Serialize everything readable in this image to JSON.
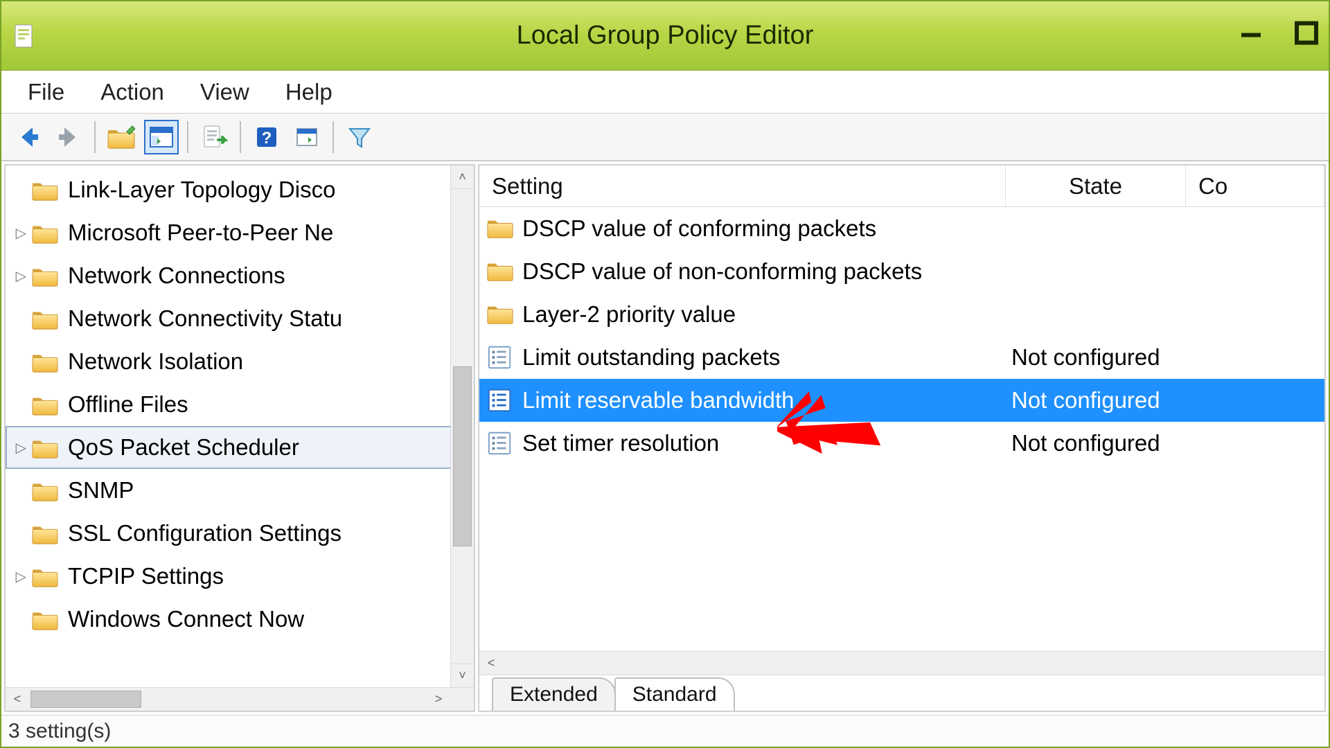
{
  "window": {
    "title": "Local Group Policy Editor"
  },
  "menu": {
    "file": "File",
    "action": "Action",
    "view": "View",
    "help": "Help"
  },
  "tree": {
    "items": [
      {
        "label": "Link-Layer Topology Disco",
        "expandable": false,
        "selected": false
      },
      {
        "label": "Microsoft Peer-to-Peer Ne",
        "expandable": true,
        "selected": false
      },
      {
        "label": "Network Connections",
        "expandable": true,
        "selected": false
      },
      {
        "label": "Network Connectivity Statu",
        "expandable": false,
        "selected": false
      },
      {
        "label": "Network Isolation",
        "expandable": false,
        "selected": false
      },
      {
        "label": "Offline Files",
        "expandable": false,
        "selected": false
      },
      {
        "label": "QoS Packet Scheduler",
        "expandable": true,
        "selected": true
      },
      {
        "label": "SNMP",
        "expandable": false,
        "selected": false
      },
      {
        "label": "SSL Configuration Settings",
        "expandable": false,
        "selected": false
      },
      {
        "label": "TCPIP Settings",
        "expandable": true,
        "selected": false
      },
      {
        "label": "Windows Connect Now",
        "expandable": false,
        "selected": false
      }
    ]
  },
  "list": {
    "columns": {
      "setting": "Setting",
      "state": "State",
      "comment": "Co"
    },
    "rows": [
      {
        "type": "folder",
        "setting": "DSCP value of conforming packets",
        "state": "",
        "selected": false
      },
      {
        "type": "folder",
        "setting": "DSCP value of non-conforming packets",
        "state": "",
        "selected": false
      },
      {
        "type": "folder",
        "setting": "Layer-2 priority value",
        "state": "",
        "selected": false
      },
      {
        "type": "setting",
        "setting": "Limit outstanding packets",
        "state": "Not configured",
        "selected": false
      },
      {
        "type": "setting",
        "setting": "Limit reservable bandwidth",
        "state": "Not configured",
        "selected": true
      },
      {
        "type": "setting",
        "setting": "Set timer resolution",
        "state": "Not configured",
        "selected": false
      }
    ]
  },
  "tabs": {
    "extended": "Extended",
    "standard": "Standard"
  },
  "status": {
    "text": "3 setting(s)"
  }
}
